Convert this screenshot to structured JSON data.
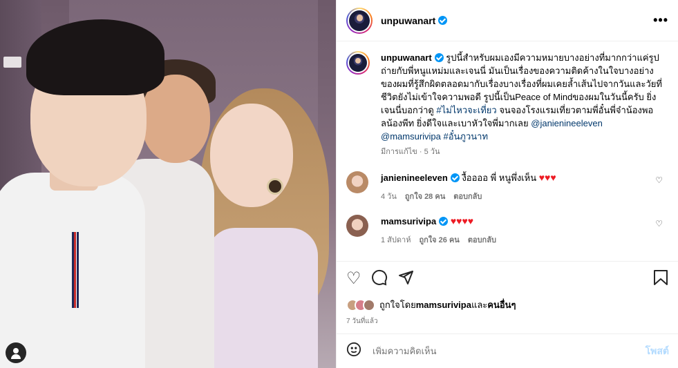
{
  "post": {
    "username": "unpuwanart",
    "more_icon": "more-horizontal-icon"
  },
  "caption": {
    "username": "unpuwanart",
    "text_1": "รูปนี้สำหรับผมเองมีความหมายบางอย่างที่มากกว่าแค่รูปถ่ายกับพี่หนูแหม่มและเจนนี่ มันเป็นเรื่องของความติดค้างในใจบางอย่างของผมที่รู้สึกผิดตลอดมากับเรื่องบางเรื่องที่ผมเคยล้ำเส้นไปจากวันและวัยที่ชีวิตยังไม่เข้าใจความพอดี รูปนี้เป็นPeace of Mindของผมในวันนี้ครับ ยิ่งเจนนี่บอกว่าดู ",
    "tag_1": "#ไม่ไหวจะเที่ยว",
    "text_2": " จนจองโรงแรมเที่ยวตามพี่อั๋นพี่จ๋าน้องพอลน้องพีท ยิ่งดีใจและเบาหัวใจพี่มากเลย ",
    "tag_2": "@janienineeleven @mamsurivipa #อั๋นภูวนาท",
    "edited": "มีการแก้ไข",
    "age": "5 วัน"
  },
  "comments": [
    {
      "username": "janienineeleven",
      "text": " งื้ออออ พี่ หนูพึ่งเห็น",
      "hearts": "♥♥♥",
      "time": "4 วัน",
      "likes": "ถูกใจ 28 คน",
      "reply": "ตอบกลับ"
    },
    {
      "username": "mamsurivipa",
      "text": "",
      "hearts": "♥♥♥♥",
      "time": "1 สัปดาห์",
      "likes": "ถูกใจ 26 คน",
      "reply": "ตอบกลับ"
    }
  ],
  "likes": {
    "prefix": "ถูกใจโดย ",
    "user": "mamsurivipa",
    "middle": " และ",
    "others": "คนอื่นๆ",
    "ago": "7 วันที่แล้ว"
  },
  "add_comment": {
    "placeholder": "เพิ่มความคิดเห็น",
    "post_label": "โพสต์"
  },
  "colors": {
    "verified": "#0095f6",
    "link": "#00376b",
    "heart": "#ed1b24",
    "post_disabled": "#b3dbff"
  }
}
